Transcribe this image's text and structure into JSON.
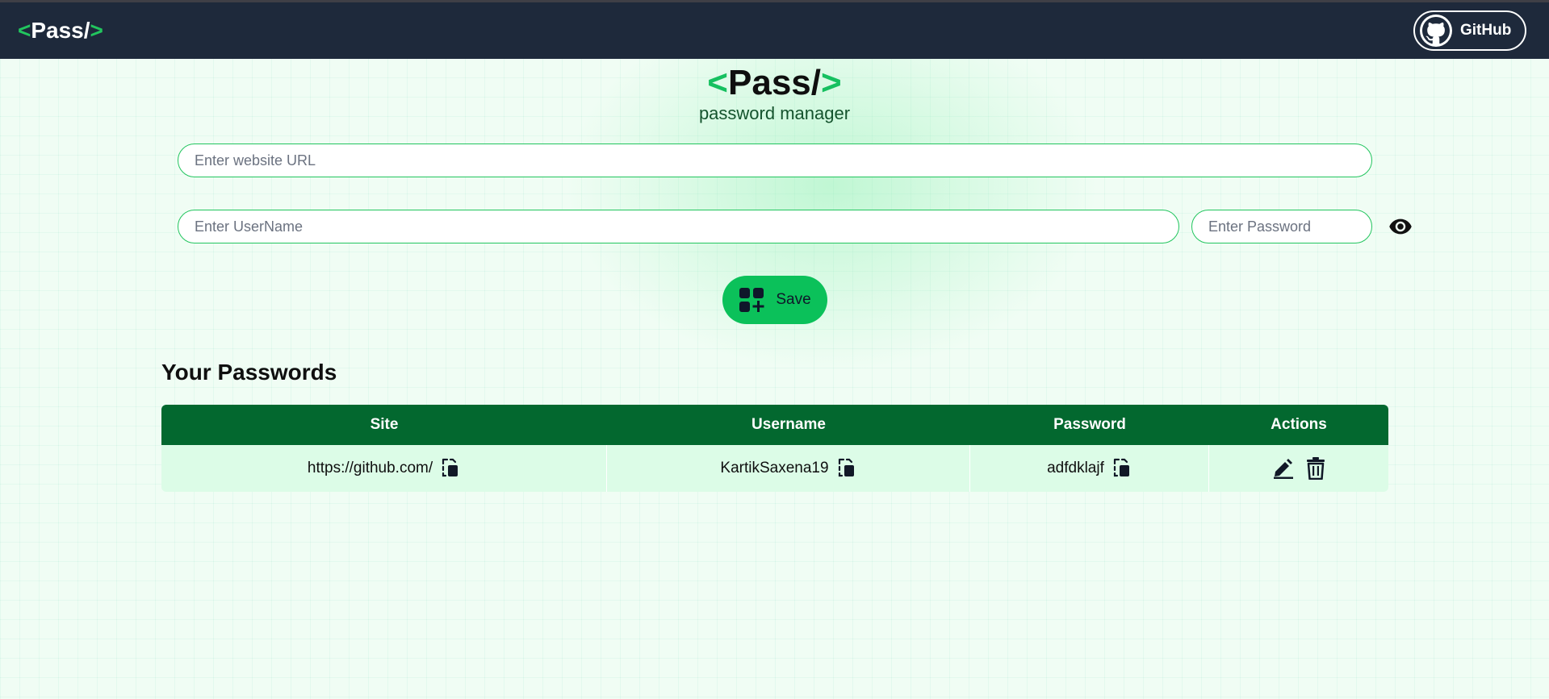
{
  "navbar": {
    "logo": {
      "open": "<",
      "name": "Pass/",
      "close": ">"
    },
    "github_label": "GitHub",
    "github_icon": "github-icon"
  },
  "hero": {
    "logo": {
      "open": "<",
      "name": "Pass/",
      "close": ">"
    },
    "subtitle": "password manager"
  },
  "form": {
    "url_placeholder": "Enter website URL",
    "url_value": "",
    "username_placeholder": "Enter UserName",
    "username_value": "",
    "password_placeholder": "Enter Password",
    "password_value": "",
    "toggle_icon": "eye-icon",
    "save_label": "Save",
    "save_icon": "add-grid-icon"
  },
  "passwords": {
    "title": "Your Passwords",
    "columns": [
      "Site",
      "Username",
      "Password",
      "Actions"
    ],
    "rows": [
      {
        "site": "https://github.com/",
        "username": "KartikSaxena19",
        "password": "adfdklajf"
      }
    ]
  },
  "colors": {
    "navbar": "#1e293b",
    "accent": "#22c55e",
    "save_button": "#0bc15a",
    "table_header": "#03682f",
    "table_row": "#dcfce7"
  }
}
